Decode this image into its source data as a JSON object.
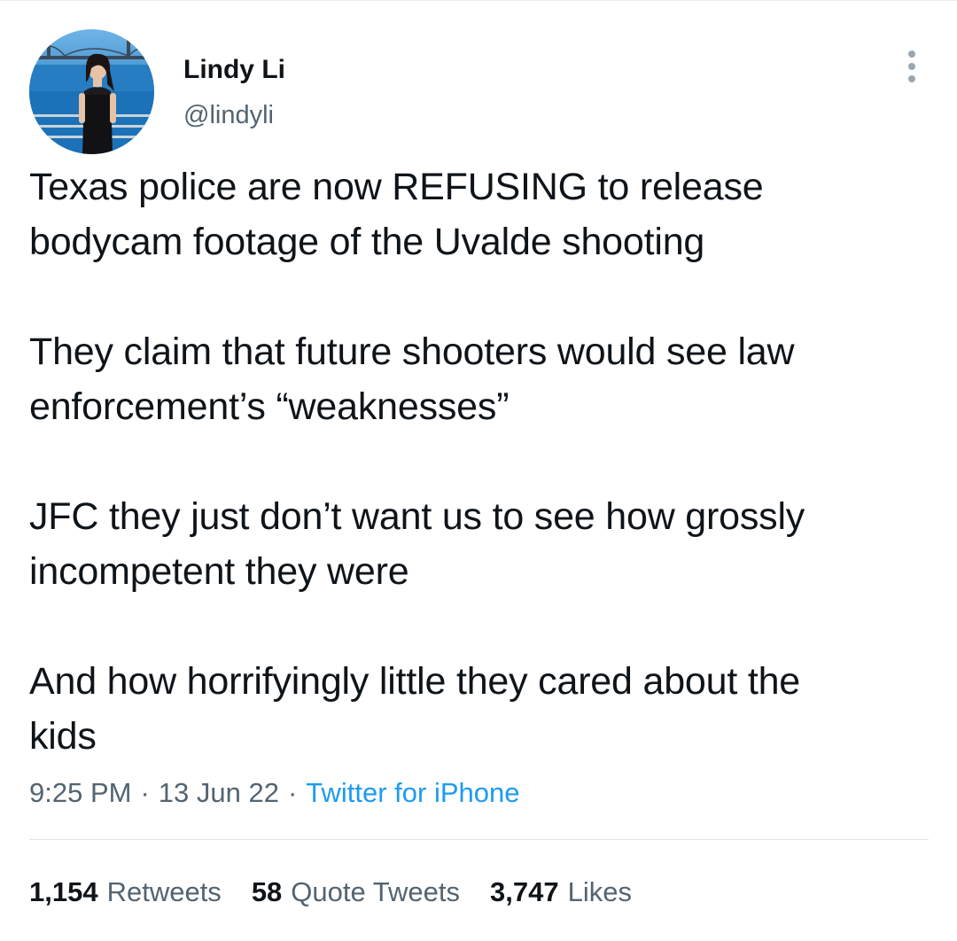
{
  "author": {
    "display_name": "Lindy Li",
    "handle": "@lindyli",
    "avatar_icon": "profile-photo"
  },
  "more_icon": "more-dots-vertical-icon",
  "tweet": {
    "paragraphs": [
      "Texas police are now REFUSING to release\nbodycam footage of the Uvalde shooting",
      "They claim that future shooters would see law\nenforcement’s “weaknesses”",
      "JFC they just don’t want us to see how grossly\nincompetent they were",
      "And how horrifyingly little they cared about the\nkids"
    ],
    "time": "9:25 PM",
    "date": "13 Jun 22",
    "separator": "·",
    "source": "Twitter for iPhone"
  },
  "stats": {
    "retweets_count": "1,154",
    "retweets_label": "Retweets",
    "quotes_count": "58",
    "quotes_label": "Quote Tweets",
    "likes_count": "3,747",
    "likes_label": "Likes"
  },
  "colors": {
    "text_primary": "#0f1419",
    "text_secondary": "#536471",
    "accent_blue": "#1d9bf0",
    "divider": "#dfe4e8"
  }
}
